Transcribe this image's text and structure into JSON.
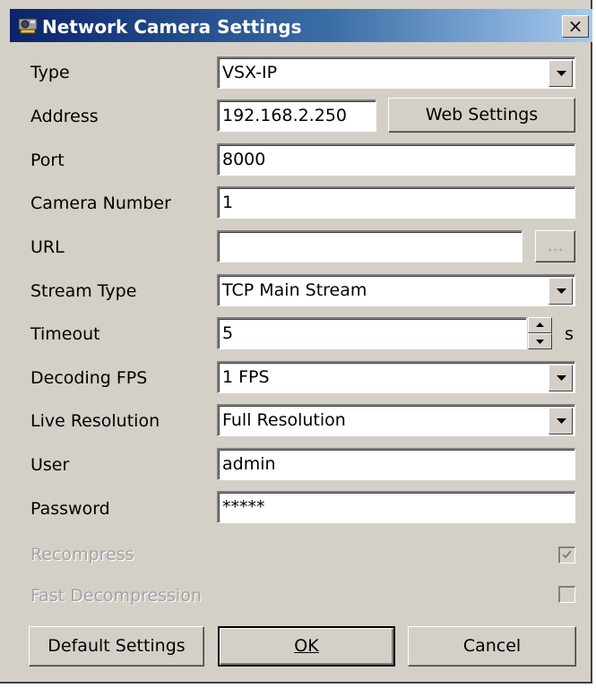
{
  "window": {
    "title": "Network Camera Settings",
    "close_label": "×",
    "icon": "camera-icon"
  },
  "labels": {
    "type": "Type",
    "address": "Address",
    "port": "Port",
    "camera_number": "Camera Number",
    "url": "URL",
    "stream_type": "Stream Type",
    "timeout": "Timeout",
    "decoding_fps": "Decoding FPS",
    "live_resolution": "Live Resolution",
    "user": "User",
    "password": "Password",
    "recompress": "Recompress",
    "fast_decompression": "Fast Decompression",
    "timeout_unit": "s"
  },
  "fields": {
    "type": "VSX-IP",
    "address": "192.168.2.250",
    "port": "8000",
    "camera_number": "1",
    "url": "",
    "stream_type": "TCP Main Stream",
    "timeout": "5",
    "decoding_fps": "1 FPS",
    "live_resolution": "Full Resolution",
    "user": "admin",
    "password": "*****"
  },
  "checkboxes": {
    "recompress": true,
    "fast_decompression": false
  },
  "buttons": {
    "web_settings": "Web Settings",
    "browse": "...",
    "default_settings": "Default Settings",
    "ok": "OK",
    "cancel": "Cancel"
  },
  "colors": {
    "title_gradient_start": "#0a246a",
    "title_gradient_end": "#a6caf0",
    "dialog_bg": "#d4d0c8",
    "disabled_text": "#a3a3a3"
  }
}
